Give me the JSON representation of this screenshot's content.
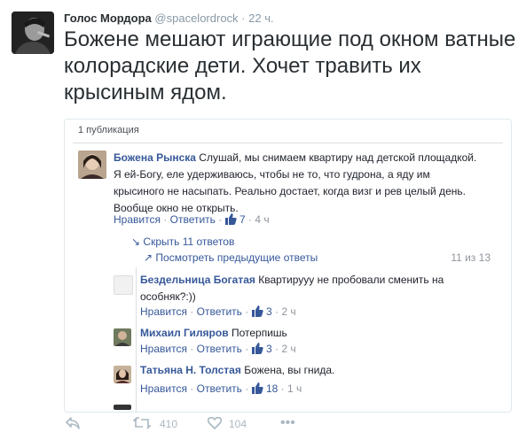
{
  "tweet": {
    "author_name": "Голос Мордора",
    "handle": "@spacelordrock",
    "separator": "·",
    "time": "22 ч.",
    "text": "Божене мешают играющие под окном ватные колорадские дети. Хочет травить их крысиным ядом."
  },
  "card": {
    "header": "1 публикация",
    "main_comment": {
      "author": "Божена Рынска",
      "text": "Слушай, мы снимаем квартиру над детской площадкой. Я ей-Богу, еле удерживаюсь, чтобы не то, что гудрона, а яду им крысиного не насыпать. Реально достает, когда визг и рев целый день. Вообще окно не открыть.",
      "like_label": "Нравится",
      "dot": "·",
      "reply_label": "Ответить",
      "likes": "7",
      "time": "4 ч"
    },
    "hide_replies": "Скрыть 11 ответов",
    "prev_replies": "Посмотреть предыдущие ответы",
    "reply_counter": "11 из 13",
    "replies": [
      {
        "author": "Бездельница Богатая",
        "text": "Квартирууу не пробовали сменить на особняк?:))",
        "like_label": "Нравится",
        "dot": "·",
        "reply_label": "Ответить",
        "likes": "3",
        "time": "2 ч"
      },
      {
        "author": "Михаил Гиляров",
        "text": "Потерпишь",
        "like_label": "Нравится",
        "dot": "·",
        "reply_label": "Ответить",
        "likes": "3",
        "time": "2 ч"
      },
      {
        "author": "Татьяна Н. Толстая",
        "text": "Божена, вы гнида.",
        "like_label": "Нравится",
        "dot": "·",
        "reply_label": "Ответить",
        "likes": "18",
        "time": "1 ч"
      }
    ]
  },
  "footer": {
    "retweets": "410",
    "likes": "104"
  },
  "colors": {
    "fb_link": "#365899",
    "meta_gray": "#90949c",
    "twitter_gray": "#8899a6",
    "footer_icon": "#aab8c2"
  },
  "icons": [
    "reply-icon",
    "retweet-icon",
    "heart-icon",
    "more-icon",
    "thumbs-up-icon",
    "arrow-icon"
  ]
}
